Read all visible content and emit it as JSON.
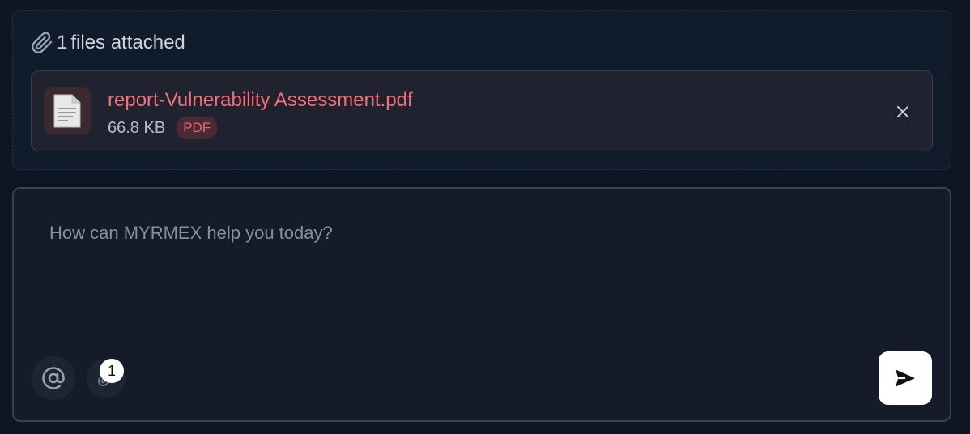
{
  "attachments": {
    "header_count": "1",
    "header_suffix": "files attached",
    "icon": "paperclip-icon",
    "files": [
      {
        "name": "report-Vulnerability Assessment.pdf",
        "size": "66.8 KB",
        "type_badge": "PDF",
        "icon": "document-icon",
        "remove_icon": "close-icon"
      }
    ]
  },
  "composer": {
    "placeholder": "How can MYRMEX help you today?",
    "value": "",
    "mention_icon": "at-sign-icon",
    "attach_icon": "paperclip-icon",
    "attach_count": "1",
    "send_icon": "send-icon"
  },
  "colors": {
    "background": "#0e1623",
    "file_name": "#f07178",
    "badge_bg": "#4a2a33",
    "send_button": "#ffffff"
  }
}
